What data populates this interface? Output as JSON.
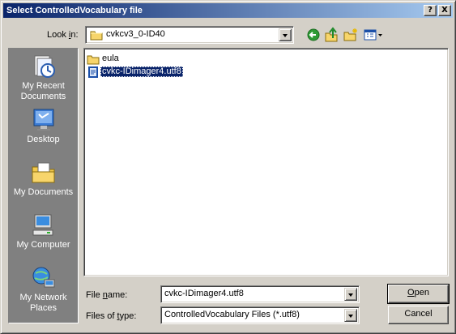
{
  "window": {
    "title": "Select ControlledVocabulary file",
    "help_button": "?",
    "close_button": "X"
  },
  "lookin": {
    "label_pre": "Look ",
    "label_key": "i",
    "label_post": "n:",
    "value": "cvkcv3_0-ID40",
    "icon": "folder-icon"
  },
  "toolbar": {
    "icons": [
      "back-icon",
      "up-one-level-icon",
      "new-folder-icon",
      "view-menu-icon"
    ]
  },
  "places": [
    {
      "label": "My Recent Documents",
      "icon": "recent-documents-icon"
    },
    {
      "label": "Desktop",
      "icon": "desktop-icon"
    },
    {
      "label": "My Documents",
      "icon": "my-documents-icon"
    },
    {
      "label": "My Computer",
      "icon": "my-computer-icon"
    },
    {
      "label": "My Network Places",
      "icon": "network-places-icon"
    }
  ],
  "files": [
    {
      "name": "eula",
      "type": "folder",
      "icon": "folder-icon",
      "selected": false
    },
    {
      "name": "cvkc-IDimager4.utf8",
      "type": "file",
      "icon": "file-icon",
      "selected": true
    }
  ],
  "filename": {
    "label_pre": "File ",
    "label_key": "n",
    "label_post": "ame:",
    "value": "cvkc-IDimager4.utf8"
  },
  "filetype": {
    "label_pre": "Files of ",
    "label_key": "t",
    "label_post": "ype:",
    "value": "ControlledVocabulary Files (*.utf8)"
  },
  "buttons": {
    "open_key": "O",
    "open_rest": "pen",
    "cancel": "Cancel"
  },
  "colors": {
    "title_start": "#0a246a",
    "title_end": "#a6caf0",
    "face": "#d4d0c8",
    "places_bg": "#808080",
    "selection": "#0a246a"
  }
}
